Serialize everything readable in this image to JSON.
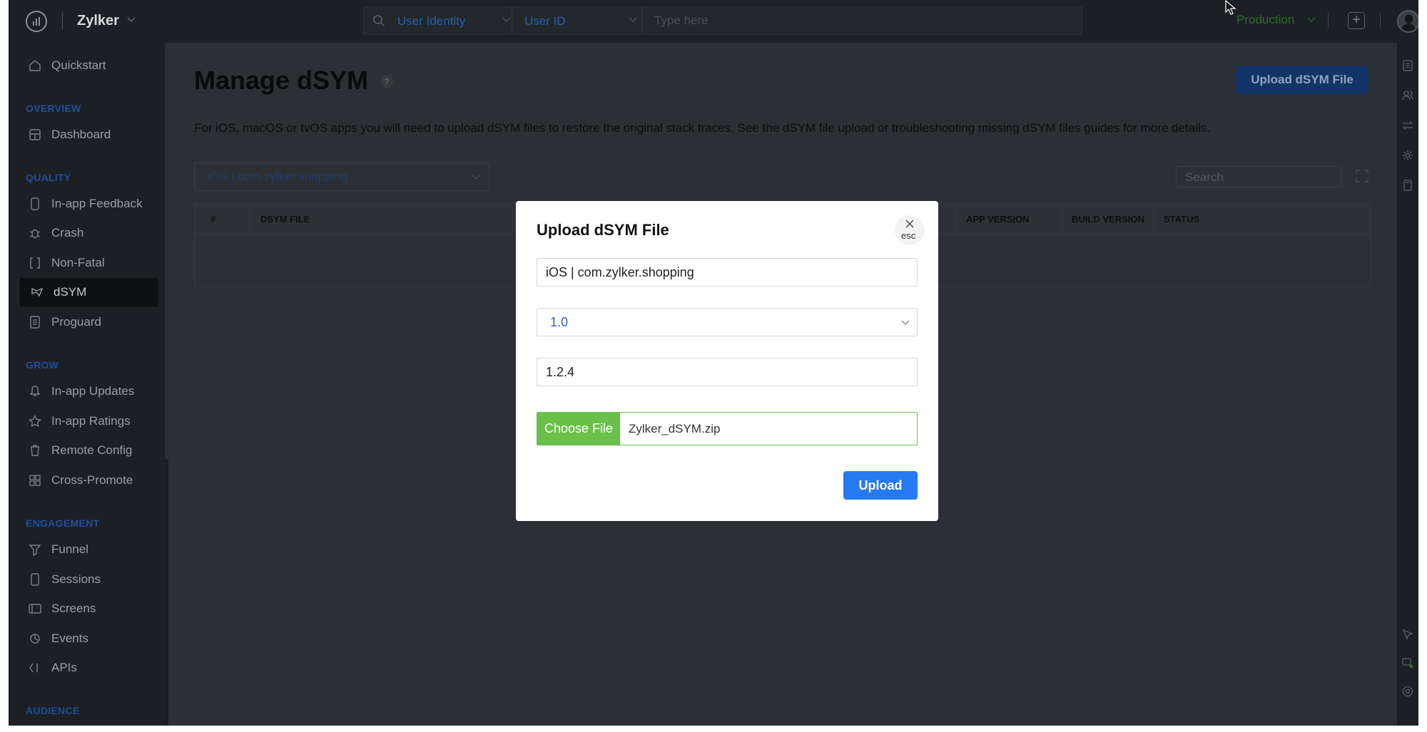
{
  "topbar": {
    "brand": "Zylker",
    "search": {
      "field1": "User Identity",
      "field2": "User ID",
      "placeholder": "Type here"
    },
    "environment": "Production"
  },
  "sidebar": {
    "items": [
      {
        "label": "Quickstart",
        "icon": "home-icon"
      },
      {
        "section": "OVERVIEW"
      },
      {
        "label": "Dashboard",
        "icon": "dashboard-icon"
      },
      {
        "section": "QUALITY"
      },
      {
        "label": "In-app Feedback",
        "icon": "feedback-icon"
      },
      {
        "label": "Crash",
        "icon": "bug-icon"
      },
      {
        "label": "Non-Fatal",
        "icon": "brackets-icon"
      },
      {
        "label": "dSYM",
        "icon": "dsym-icon",
        "active": true
      },
      {
        "label": "Proguard",
        "icon": "document-icon"
      },
      {
        "section": "GROW"
      },
      {
        "label": "In-app Updates",
        "icon": "bell-icon"
      },
      {
        "label": "In-app Ratings",
        "icon": "star-icon"
      },
      {
        "label": "Remote Config",
        "icon": "trash-icon"
      },
      {
        "label": "Cross-Promote",
        "icon": "grid-icon"
      },
      {
        "section": "ENGAGEMENT"
      },
      {
        "label": "Funnel",
        "icon": "funnel-icon"
      },
      {
        "label": "Sessions",
        "icon": "phone-icon"
      },
      {
        "label": "Screens",
        "icon": "screen-icon"
      },
      {
        "label": "Events",
        "icon": "events-icon"
      },
      {
        "label": "APIs",
        "icon": "api-icon"
      },
      {
        "section": "AUDIENCE"
      }
    ]
  },
  "main": {
    "title": "Manage dSYM",
    "help": "?",
    "upload_button": "Upload dSYM File",
    "description": "For iOS, macOS or tvOS apps you will need to upload dSYM files to restore the original stack traces. See the dSYM file upload or troubleshooting missing dSYM files guides for more details.",
    "app_select": "iOS | com.zylker.shopping",
    "search_placeholder": "Search",
    "table": {
      "columns": [
        "#",
        "DSYM FILE",
        "APP VERSION",
        "BUILD VERSION",
        "STATUS"
      ]
    }
  },
  "modal": {
    "title": "Upload dSYM File",
    "close_label": "esc",
    "app_field": "iOS | com.zylker.shopping",
    "version_select": "1.0",
    "build_field": "1.2.4",
    "choose_file_label": "Choose File",
    "file_name": "Zylker_dSYM.zip",
    "upload_label": "Upload"
  },
  "colors": {
    "accent": "#2679f0",
    "choose_file": "#6ac04a",
    "environment": "#2d6e2d"
  }
}
